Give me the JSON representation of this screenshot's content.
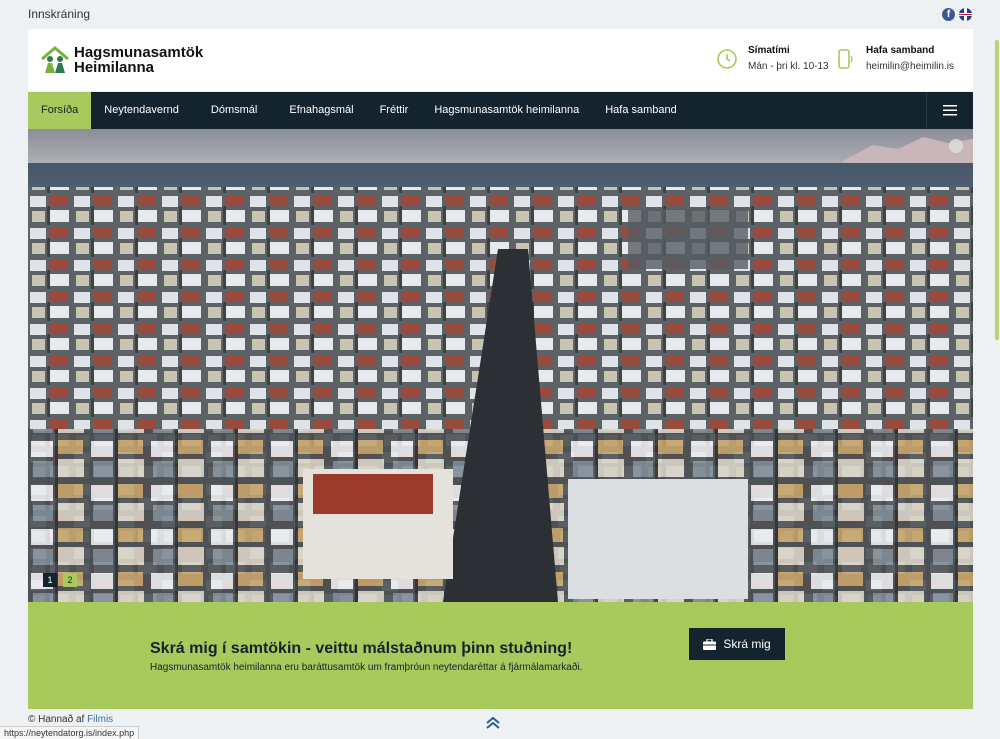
{
  "topbar": {
    "login_label": "Innskráning"
  },
  "header": {
    "brand_line1": "Hagsmunasamtök",
    "brand_line2": "Heimilanna",
    "phone": {
      "title": "Símatími",
      "value": "Mán - þri kl. 10-13"
    },
    "contact": {
      "title": "Hafa samband",
      "value": "heimilin@heimilin.is"
    }
  },
  "nav": {
    "items": [
      {
        "label": "Forsíða",
        "active": true
      },
      {
        "label": "Neytendavernd",
        "active": false
      },
      {
        "label": "Dómsmál",
        "active": false
      },
      {
        "label": "Efnahagsmál",
        "active": false
      },
      {
        "label": "Fréttir",
        "active": false
      },
      {
        "label": "Hagsmunasamtök heimilanna",
        "active": false
      },
      {
        "label": "Hafa samband",
        "active": false
      }
    ]
  },
  "slider": {
    "pages": [
      "1",
      "2"
    ],
    "active_page": "2"
  },
  "cta": {
    "title": "Skrá mig í samtökin - veittu málstaðnum þinn stuðning!",
    "subtitle": "Hagsmunasamtök heimilanna eru baráttusamtök um framþróun neytendaréttar á fjármálamarkaði.",
    "button_label": "Skrá mig"
  },
  "footer": {
    "prefix": "© Hannað af",
    "link": "Filmis"
  },
  "status_url": "https://neytendatorg.is/index.php",
  "colors": {
    "accent": "#a8c95c",
    "dark": "#13242e",
    "background": "#eef1f3"
  },
  "icons": [
    "facebook-icon",
    "uk-flag-icon",
    "clock-icon",
    "phone-icon",
    "hamburger-menu-icon",
    "briefcase-icon",
    "chevron-up-double-icon"
  ]
}
